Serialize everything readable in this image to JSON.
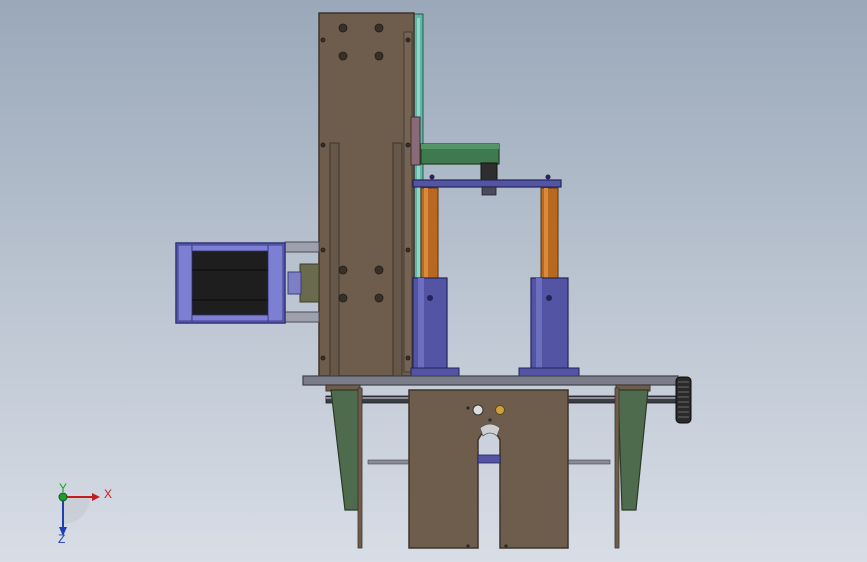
{
  "viewport": {
    "name": "cad-viewport",
    "background_top": "#9aa8b9",
    "background_bottom": "#d8dde6"
  },
  "model": {
    "parts": [
      "vertical-column-plate",
      "stepper-motor",
      "motor-mount",
      "top-crossbar",
      "guide-posts",
      "lift-cylinders",
      "base-plate",
      "side-brackets",
      "front-panel",
      "hand-wheel",
      "lead-screw"
    ],
    "colors": {
      "plate": "#6e5c4c",
      "plate_edge": "#3e342c",
      "teal": "#5fb6a6",
      "green": "#3f7a4e",
      "blue_metal": "#5355a4",
      "orange_post": "#b8691f",
      "motor_body": "#1e1e1e",
      "motor_cap": "#6a6cc0",
      "base": "#7c7d8a",
      "bracket_green": "#4f6b4d",
      "wheel": "#2a2a2a"
    }
  },
  "triad": {
    "x_label": "X",
    "y_label": "Y",
    "z_label": "Z",
    "x_color": "#c21e1e",
    "y_color": "#1f9b2b",
    "z_color": "#1f3fb0"
  }
}
